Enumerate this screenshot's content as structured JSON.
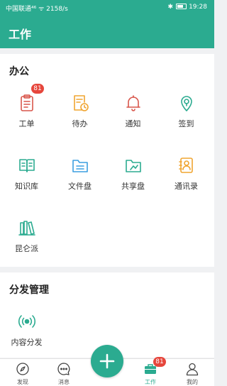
{
  "status_bar": {
    "left_text": "中国联通⁴⁶ ᯤ 2158/s",
    "time": "19:28"
  },
  "header": {
    "title": "工作"
  },
  "office": {
    "title": "办公",
    "items": [
      {
        "label": "工单",
        "icon": "clipboard-icon",
        "badge": "81"
      },
      {
        "label": "待办",
        "icon": "todo-clock-icon"
      },
      {
        "label": "通知",
        "icon": "bell-icon"
      },
      {
        "label": "签到",
        "icon": "location-pin-icon"
      },
      {
        "label": "知识库",
        "icon": "book-icon"
      },
      {
        "label": "文件盘",
        "icon": "folder-icon"
      },
      {
        "label": "共享盘",
        "icon": "shared-folder-icon"
      },
      {
        "label": "通讯录",
        "icon": "contacts-icon"
      },
      {
        "label": "昆仑派",
        "icon": "books-icon"
      }
    ]
  },
  "distribution": {
    "title": "分发管理",
    "items": [
      {
        "label": "内容分发",
        "icon": "broadcast-icon"
      }
    ]
  },
  "tabbar": {
    "tabs": [
      {
        "label": "发现",
        "icon": "compass-icon"
      },
      {
        "label": "消息",
        "icon": "chat-icon"
      },
      {
        "label": "工作",
        "icon": "briefcase-icon",
        "badge": "81",
        "active": true
      },
      {
        "label": "我的",
        "icon": "person-icon"
      }
    ]
  },
  "colors": {
    "primary": "#2bab90",
    "badge": "#e6463c",
    "red": "#d9564b",
    "orange": "#f0a531",
    "blue": "#3b9fe0"
  }
}
